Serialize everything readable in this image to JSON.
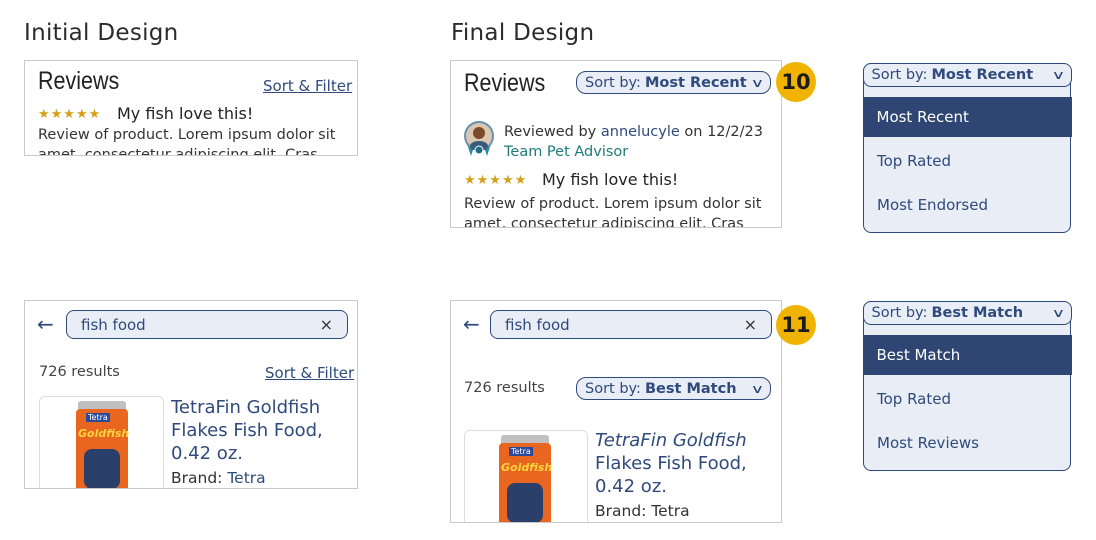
{
  "headings": {
    "initial": "Initial Design",
    "final": "Final Design"
  },
  "initial_reviews": {
    "title": "Reviews",
    "sort_filter": "Sort & Filter",
    "stars": "★★★★★",
    "review_title": "My fish love this!",
    "review_body_1": "Review of product. Lorem ipsum dolor sit",
    "review_body_2": "amet, consectetur adipiscing elit. Cras"
  },
  "final_reviews": {
    "title": "Reviews",
    "sort_prefix": "Sort by:",
    "sort_value": "Most Recent",
    "reviewed_by": "Reviewed by",
    "reviewer": "annelucyle",
    "on_date": "on 12/2/23",
    "advisor": "Team Pet Advisor",
    "stars": "★★★★★",
    "review_title": "My fish love this!",
    "review_body_1": "Review of product. Lorem ipsum dolor sit",
    "review_body_2": "amet, consectetur adipiscing elit. Cras",
    "badge": "10"
  },
  "reviews_menu": {
    "sort_prefix": "Sort by:",
    "sort_value": "Most Recent",
    "options": [
      "Most Recent",
      "Top Rated",
      "Most Endorsed"
    ],
    "selected_index": 0
  },
  "initial_search": {
    "query": "fish food",
    "clear": "×",
    "results": "726 results",
    "sort_filter": "Sort & Filter",
    "product_name_1": "TetraFin Goldfish",
    "product_name_2": "Flakes Fish Food,",
    "product_name_3": "0.42 oz.",
    "brand_label": "Brand:",
    "brand_value": "Tetra",
    "can_brand": "Tetra",
    "can_label": "Goldfish"
  },
  "final_search": {
    "query": "fish food",
    "clear": "×",
    "results": "726 results",
    "sort_prefix": "Sort by:",
    "sort_value": "Best Match",
    "product_name_1": "TetraFin Goldfish",
    "product_name_2": "Flakes Fish Food,",
    "product_name_3": "0.42 oz.",
    "brand_full": "Brand: Tetra",
    "badge": "11",
    "can_brand": "Tetra",
    "can_label": "Goldfish"
  },
  "search_menu": {
    "sort_prefix": "Sort by:",
    "sort_value": "Best Match",
    "options": [
      "Best Match",
      "Top Rated",
      "Most Reviews"
    ],
    "selected_index": 0
  },
  "icons": {
    "back": "back-arrow-icon",
    "chevron": "chevron-down-icon",
    "clear": "close-icon",
    "star": "star-icon"
  },
  "colors": {
    "accent": "#2f4a7c",
    "accent_fill": "#e9edf6",
    "selected": "#2f4573",
    "badge": "#f0b400",
    "stars": "#d4a017"
  }
}
